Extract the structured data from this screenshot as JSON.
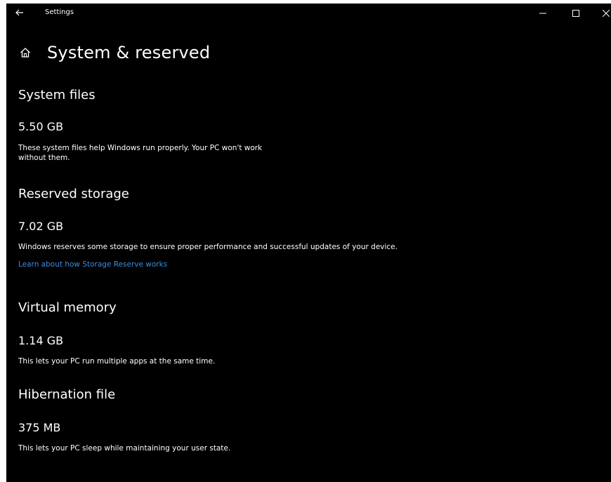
{
  "window": {
    "title": "Settings"
  },
  "page": {
    "title": "System & reserved"
  },
  "sections": [
    {
      "title": "System files",
      "size": "5.50 GB",
      "desc_line1": "These system files help Windows run properly. Your PC won't work",
      "desc_line2": "without them."
    },
    {
      "title": "Reserved storage",
      "size": "7.02 GB",
      "desc_line1": "Windows reserves some storage to ensure proper performance and successful updates of your device.",
      "link": "Learn about how Storage Reserve works"
    },
    {
      "title": "Virtual memory",
      "size": "1.14 GB",
      "desc_line1": "This lets your PC run multiple apps at the same time."
    },
    {
      "title": "Hibernation file",
      "size": "375 MB",
      "desc_line1": "This lets your PC sleep while maintaining your user state."
    }
  ],
  "colors": {
    "background": "#000000",
    "text": "#ffffff",
    "link": "#3a8fdc"
  },
  "icons": {
    "back": "back-arrow-icon",
    "home": "home-icon",
    "minimize": "minimize-icon",
    "maximize": "maximize-icon",
    "close": "close-icon"
  }
}
